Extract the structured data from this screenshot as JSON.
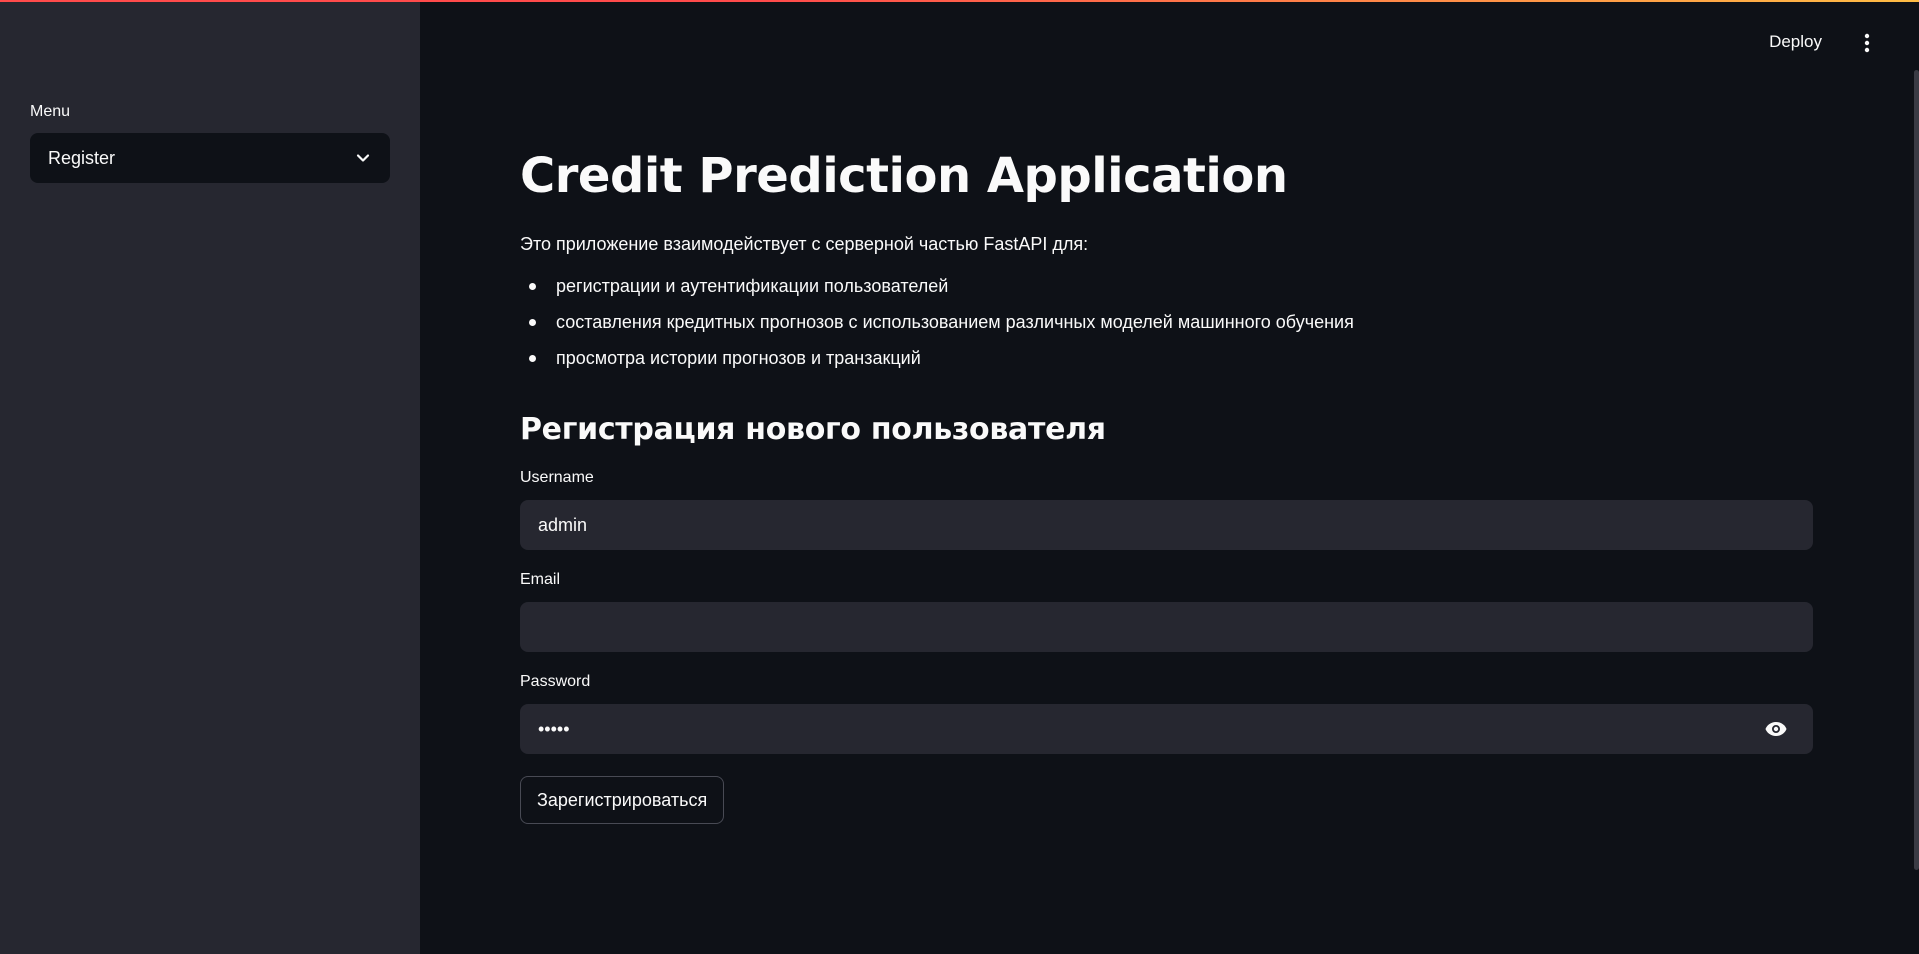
{
  "sidebar": {
    "menu_label": "Menu",
    "menu_selected": "Register",
    "menu_icon": "chevron-down-icon"
  },
  "header": {
    "deploy_label": "Deploy",
    "menu_icon": "vertical-ellipsis-icon"
  },
  "main": {
    "title": "Credit Prediction Application",
    "intro": "Это приложение взаимодействует с серверной частью FastAPI для:",
    "bullets": [
      "регистрации и аутентификации пользователей",
      "составления кредитных прогнозов с использованием различных моделей машинного обучения",
      "просмотра истории прогнозов и транзакций"
    ],
    "form_title": "Регистрация нового пользователя",
    "username": {
      "label": "Username",
      "value": "admin"
    },
    "email": {
      "label": "Email",
      "value": ""
    },
    "password": {
      "label": "Password",
      "value": "•••••",
      "toggle_icon": "eye-icon"
    },
    "submit_label": "Зарегистрироваться"
  },
  "colors": {
    "background": "#0e1117",
    "sidebar_background": "#262730",
    "input_background": "#262730",
    "text": "#fafafa",
    "accent_gradient_start": "#ff4b4b",
    "accent_gradient_end": "#ffbd45"
  }
}
